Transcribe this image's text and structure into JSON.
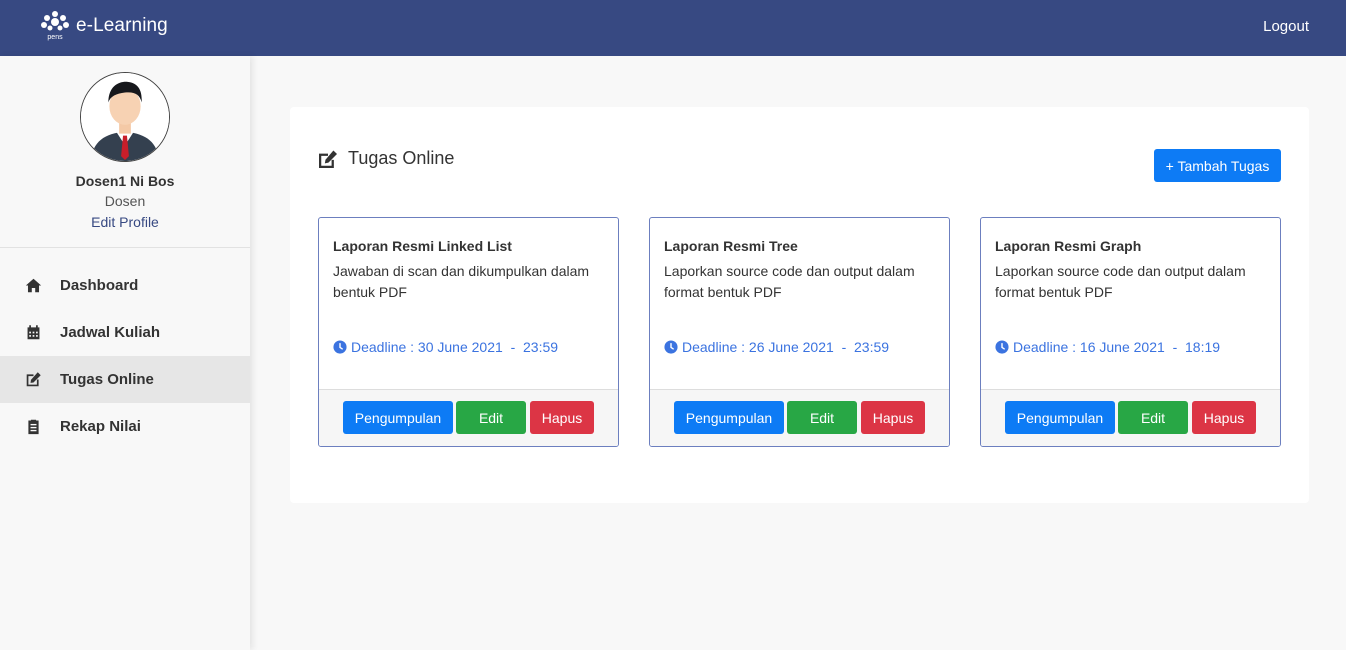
{
  "navbar": {
    "brand_title": "e-Learning",
    "brand_logo_text": "pens",
    "logout_label": "Logout"
  },
  "profile": {
    "name": "Dosen1 Ni Bos",
    "role": "Dosen",
    "edit_link": "Edit Profile"
  },
  "sidebar": {
    "items": [
      {
        "label": "Dashboard",
        "icon": "home-icon"
      },
      {
        "label": "Jadwal Kuliah",
        "icon": "calendar-icon"
      },
      {
        "label": "Tugas Online",
        "icon": "edit-icon",
        "active": true
      },
      {
        "label": "Rekap Nilai",
        "icon": "clipboard-icon"
      }
    ]
  },
  "main": {
    "title": "Tugas Online",
    "add_button_label": "+ Tambah Tugas",
    "tasks": [
      {
        "title": "Laporan Resmi Linked List",
        "description": "Jawaban di scan dan dikumpulkan dalam bentuk PDF",
        "deadline": "Deadline : 30 June 2021  -  23:59",
        "submit_label": "Pengumpulan",
        "edit_label": "Edit",
        "delete_label": "Hapus"
      },
      {
        "title": "Laporan Resmi Tree",
        "description": "Laporkan source code dan output dalam format bentuk PDF",
        "deadline": "Deadline : 26 June 2021  -  23:59",
        "submit_label": "Pengumpulan",
        "edit_label": "Edit",
        "delete_label": "Hapus"
      },
      {
        "title": "Laporan Resmi Graph",
        "description": "Laporkan source code dan output dalam format bentuk PDF",
        "deadline": "Deadline : 16 June 2021  -  18:19",
        "submit_label": "Pengumpulan",
        "edit_label": "Edit",
        "delete_label": "Hapus"
      }
    ]
  },
  "colors": {
    "navbar": "#374982",
    "primary": "#0d7bf5",
    "success": "#28a745",
    "danger": "#dc3545",
    "deadline": "#3b73e0",
    "card_border": "#6c7fbf"
  }
}
